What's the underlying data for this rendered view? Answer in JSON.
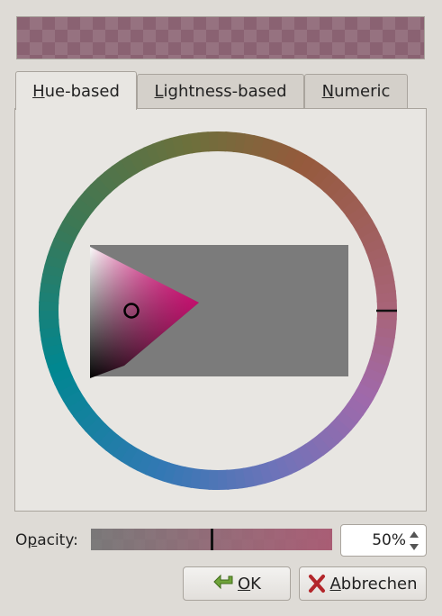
{
  "preview": {
    "color": "#8a6272"
  },
  "tabs": [
    {
      "id": "hue",
      "mnemonic": "H",
      "rest": "ue-based",
      "active": true
    },
    {
      "id": "lightness",
      "mnemonic": "L",
      "rest": "ightness-based",
      "active": false
    },
    {
      "id": "numeric",
      "mnemonic": "N",
      "rest": "umeric",
      "active": false
    }
  ],
  "wheel": {
    "hue_marker_deg": 0,
    "selected_hue_color": "#ee0f84"
  },
  "opacity": {
    "label_pre": "O",
    "label_mnemonic": "p",
    "label_post": "acity:",
    "value_fraction": 0.5,
    "spin_value": "50%"
  },
  "buttons": {
    "ok": {
      "mnemonic": "O",
      "rest": "K",
      "icon": "green-check-arrow-icon"
    },
    "cancel": {
      "mnemonic": "A",
      "rest": "bbrechen",
      "icon": "red-x-icon"
    }
  }
}
